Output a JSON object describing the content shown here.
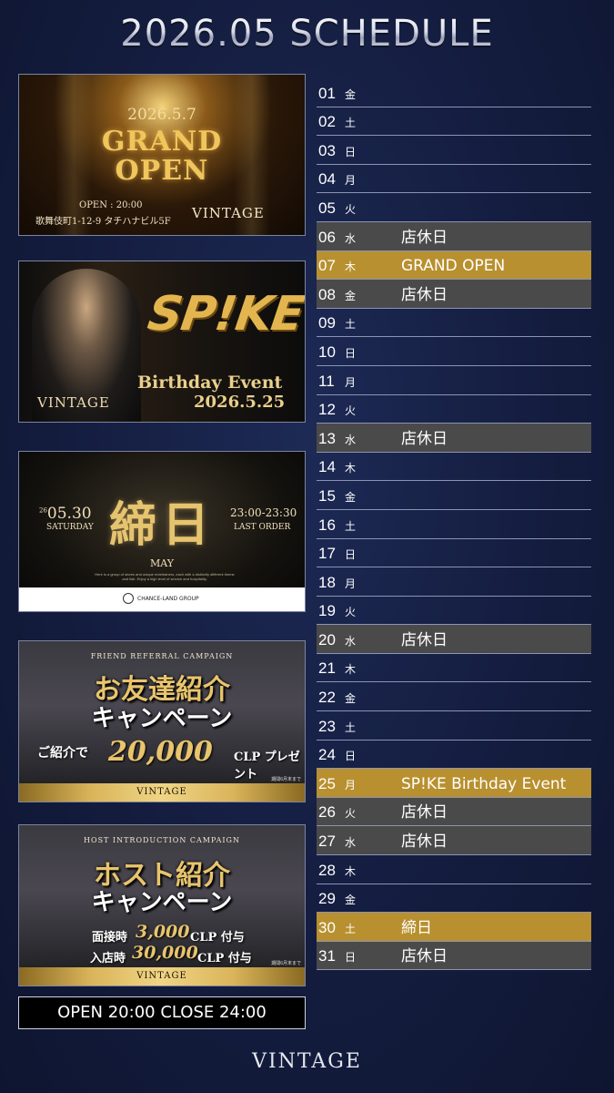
{
  "title": "2026.05 SCHEDULE",
  "banners": {
    "grand_open": {
      "date": "2026.5.7",
      "line1": "GRAND",
      "line2": "OPEN",
      "open_time": "OPEN : 20:00",
      "address": "歌舞伎町1-12-9 タチハナビル5F",
      "brand": "VINTAGE"
    },
    "birthday": {
      "logo": "SP!KE",
      "event": "Birthday Event",
      "date": "2026.5.25",
      "brand": "VINTAGE"
    },
    "shime": {
      "kanji": "締日",
      "date": "05.30",
      "date_prefix": "26",
      "weekday": "SATURDAY",
      "time": "23:00-23:30",
      "last_order": "LAST ORDER",
      "month": "MAY",
      "blurb": "Here is a group of stores and unique entertainers, each with a distinctly different theme and flair. Enjoy a high level of service and hospitality.",
      "group": "CHANCE-LAND GROUP"
    },
    "friend": {
      "top": "FRIEND REFERRAL CAMPAIGN",
      "line1": "お友達紹介",
      "line2": "キャンペーン",
      "prefix": "ご紹介で",
      "amount": "20,000",
      "unit": "CLP プレゼント",
      "note": "期間6月末まで",
      "brand": "VINTAGE"
    },
    "host": {
      "top": "HOST INTRODUCTION CAMPAIGN",
      "line1": "ホスト紹介",
      "line2": "キャンペーン",
      "row1_label": "面接時",
      "row1_amount": "3,000",
      "row1_unit": "CLP 付与",
      "row2_label": "入店時",
      "row2_amount": "30,000",
      "row2_unit": "CLP 付与",
      "note": "期間6月末まで",
      "brand": "VINTAGE"
    }
  },
  "hours": "OPEN 20:00 CLOSE 24:00",
  "footer_brand": "VINTAGE",
  "schedule": [
    {
      "day": "01",
      "weekday": "金",
      "event": "",
      "type": "normal"
    },
    {
      "day": "02",
      "weekday": "土",
      "event": "",
      "type": "normal"
    },
    {
      "day": "03",
      "weekday": "日",
      "event": "",
      "type": "normal"
    },
    {
      "day": "04",
      "weekday": "月",
      "event": "",
      "type": "normal"
    },
    {
      "day": "05",
      "weekday": "火",
      "event": "",
      "type": "normal"
    },
    {
      "day": "06",
      "weekday": "水",
      "event": "店休日",
      "type": "closed"
    },
    {
      "day": "07",
      "weekday": "木",
      "event": "GRAND OPEN",
      "type": "event"
    },
    {
      "day": "08",
      "weekday": "金",
      "event": "店休日",
      "type": "closed"
    },
    {
      "day": "09",
      "weekday": "土",
      "event": "",
      "type": "normal"
    },
    {
      "day": "10",
      "weekday": "日",
      "event": "",
      "type": "normal"
    },
    {
      "day": "11",
      "weekday": "月",
      "event": "",
      "type": "normal"
    },
    {
      "day": "12",
      "weekday": "火",
      "event": "",
      "type": "normal"
    },
    {
      "day": "13",
      "weekday": "水",
      "event": "店休日",
      "type": "closed"
    },
    {
      "day": "14",
      "weekday": "木",
      "event": "",
      "type": "normal"
    },
    {
      "day": "15",
      "weekday": "金",
      "event": "",
      "type": "normal"
    },
    {
      "day": "16",
      "weekday": "土",
      "event": "",
      "type": "normal"
    },
    {
      "day": "17",
      "weekday": "日",
      "event": "",
      "type": "normal"
    },
    {
      "day": "18",
      "weekday": "月",
      "event": "",
      "type": "normal"
    },
    {
      "day": "19",
      "weekday": "火",
      "event": "",
      "type": "normal"
    },
    {
      "day": "20",
      "weekday": "水",
      "event": "店休日",
      "type": "closed"
    },
    {
      "day": "21",
      "weekday": "木",
      "event": "",
      "type": "normal"
    },
    {
      "day": "22",
      "weekday": "金",
      "event": "",
      "type": "normal"
    },
    {
      "day": "23",
      "weekday": "土",
      "event": "",
      "type": "normal"
    },
    {
      "day": "24",
      "weekday": "日",
      "event": "",
      "type": "normal"
    },
    {
      "day": "25",
      "weekday": "月",
      "event": "SP!KE Birthday Event",
      "type": "event"
    },
    {
      "day": "26",
      "weekday": "火",
      "event": "店休日",
      "type": "closed"
    },
    {
      "day": "27",
      "weekday": "水",
      "event": "店休日",
      "type": "closed"
    },
    {
      "day": "28",
      "weekday": "木",
      "event": "",
      "type": "normal"
    },
    {
      "day": "29",
      "weekday": "金",
      "event": "",
      "type": "normal"
    },
    {
      "day": "30",
      "weekday": "土",
      "event": "締日",
      "type": "event"
    },
    {
      "day": "31",
      "weekday": "日",
      "event": "店休日",
      "type": "closed"
    }
  ],
  "colors": {
    "background": "#141d3f",
    "closed_row": "#4a4a4a",
    "event_row": "#b8902f",
    "gold": "#e7c77a"
  }
}
